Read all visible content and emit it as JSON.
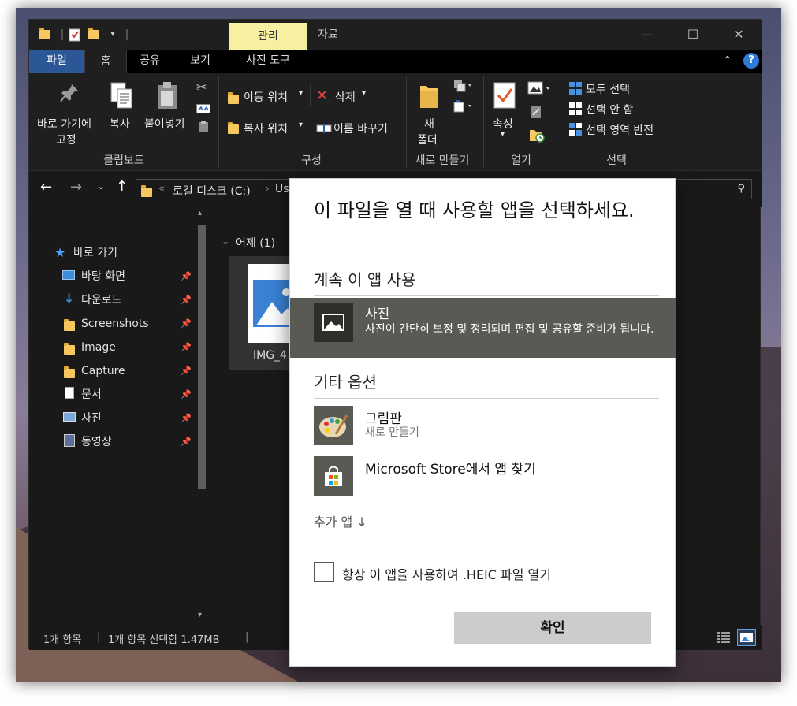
{
  "titlebar": {
    "context_tab_manage": "관리",
    "context_tab_data": "자료",
    "minimize": "—",
    "maximize": "☐",
    "close": "✕"
  },
  "tabs": [
    {
      "label": "파일"
    },
    {
      "label": "홈"
    },
    {
      "label": "공유"
    },
    {
      "label": "보기"
    },
    {
      "label": "사진 도구"
    }
  ],
  "help": "?",
  "ribbon": {
    "clipboard": {
      "label": "클립보드",
      "pin_line1": "바로 가기에",
      "pin_line2": "고정",
      "copy": "복사",
      "paste": "붙여넣기"
    },
    "organize": {
      "label": "구성",
      "move_to": "이동 위치",
      "copy_to": "복사 위치",
      "delete": "삭제",
      "rename": "이름 바꾸기"
    },
    "new": {
      "label": "새로 만들기",
      "new_folder_line1": "새",
      "new_folder_line2": "폴더"
    },
    "open": {
      "label": "열기",
      "properties": "속성"
    },
    "select": {
      "label": "선택",
      "select_all": "모두 선택",
      "select_none": "선택 안 함",
      "invert": "선택 영역 반전"
    }
  },
  "address": {
    "path_prefix": "«",
    "path_drive": "로컬 디스크 (C:)",
    "path_next": "Us"
  },
  "nav": {
    "quick_access": "바로 가기",
    "items": [
      {
        "label": "바탕 화면"
      },
      {
        "label": "다운로드"
      },
      {
        "label": "Screenshots"
      },
      {
        "label": "Image"
      },
      {
        "label": "Capture"
      },
      {
        "label": "문서"
      },
      {
        "label": "사진"
      },
      {
        "label": "동영상"
      }
    ]
  },
  "content": {
    "group_header": "어제 (1)",
    "file_name": "IMG_4"
  },
  "status": {
    "item_count": "1개 항목",
    "selection": "1개 항목 선택함 1.47MB"
  },
  "dialog": {
    "title": "이 파일을 열 때 사용할 앱을 선택하세요.",
    "keep_using": "계속 이 앱 사용",
    "recommended": {
      "name": "사진",
      "desc": "사진이 간단히 보정 및 정리되며 편집 및 공유할 준비가 됩니다."
    },
    "other_options": "기타 옵션",
    "other_apps": [
      {
        "name": "그림판",
        "desc": "새로 만들기"
      },
      {
        "name": "Microsoft Store에서 앱 찾기",
        "desc": ""
      }
    ],
    "more_apps": "추가 앱 ↓",
    "always_use": "항상 이 앱을 사용하여 .HEIC 파일 열기",
    "ok": "확인"
  }
}
